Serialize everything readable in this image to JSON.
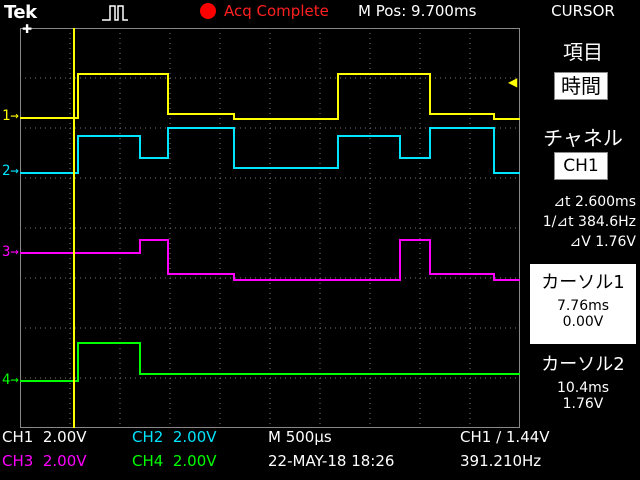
{
  "brand": "Tek",
  "header": {
    "acq_status": "Acq Complete",
    "mpos": "M Pos: 9.700ms"
  },
  "menu": {
    "title": "CURSOR",
    "item_label": "項目",
    "item_value": "時間",
    "channel_label": "チャネル",
    "channel_value": "CH1",
    "delta_t": "⊿t 2.600ms",
    "freq": "1/⊿t 384.6Hz",
    "delta_v": "⊿V 1.76V",
    "cursor1": {
      "label": "カーソル1",
      "time": "7.76ms",
      "volt": "0.00V"
    },
    "cursor2": {
      "label": "カーソル2",
      "time": "10.4ms",
      "volt": "1.76V"
    }
  },
  "bottom": {
    "ch1": "CH1  2.00V",
    "ch2": "CH2  2.00V",
    "ch3": "CH3  2.00V",
    "ch4": "CH4  2.00V",
    "timebase": "M 500μs",
    "date": "22-MAY-18 18:26",
    "trigger": "CH1 ∕ 1.44V",
    "trig_freq": "391.210Hz"
  },
  "channels": [
    {
      "id": "1",
      "color": "#ffff00"
    },
    {
      "id": "2",
      "color": "#00e5ff"
    },
    {
      "id": "3",
      "color": "#ff00ff"
    },
    {
      "id": "4",
      "color": "#00ff00"
    }
  ],
  "colors": {
    "ch1": "#ffff00",
    "ch2": "#00e5ff",
    "ch3": "#ff00ff",
    "ch4": "#00ff00",
    "acq": "#ff0000"
  }
}
